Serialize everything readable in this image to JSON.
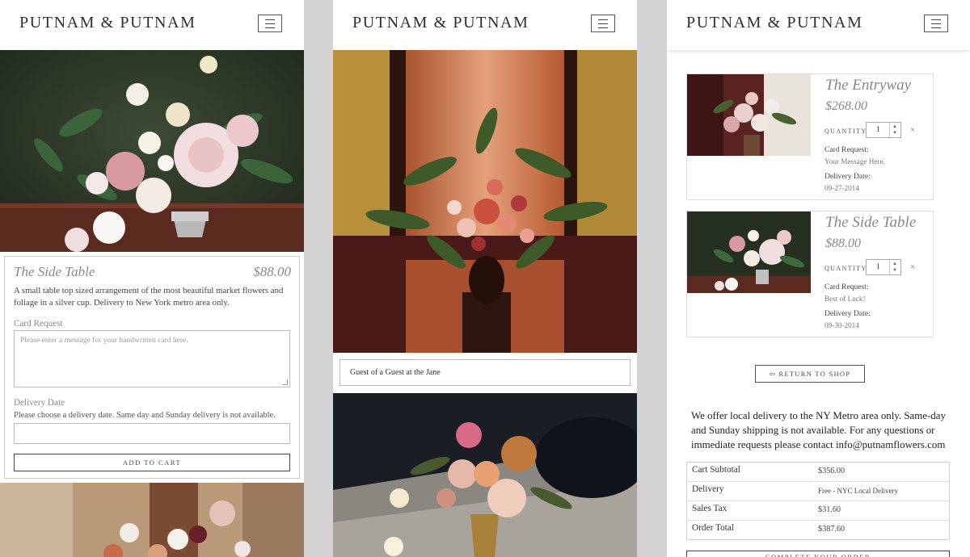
{
  "brand": "PUTNAM & PUTNAM",
  "colors": {
    "text": "#333333",
    "border": "#cccccc",
    "muted": "#888888",
    "gutter": "#d4d4d4"
  },
  "icons": {
    "menu": "hamburger-icon",
    "return": "arrow-left-icon",
    "remove": "close-icon"
  },
  "product": {
    "title": "The Side Table",
    "price": "$88.00",
    "description": "A small table top sized arrangement of the most beautiful market flowers and foliage in a silver cup. Delivery to New York metro area only.",
    "card_request_label": "Card Request",
    "card_request_placeholder": "Please enter a message for your handwritten card here.",
    "delivery_date_label": "Delivery Date",
    "delivery_date_help": "Please choose a delivery date. Same day and Sunday delivery is not available.",
    "add_to_cart": "ADD TO CART"
  },
  "gallery": {
    "caption": "Guest of a Guest at the Jane"
  },
  "cart": {
    "quantity_label": "QUANTITY",
    "card_request_label": "Card Request:",
    "delivery_date_label": "Delivery Date:",
    "remove_symbol": "×",
    "items": [
      {
        "title": "The Entryway",
        "price": "$268.00",
        "quantity": "1",
        "card_message": "Your Message Here.",
        "delivery_date": "09-27-2014"
      },
      {
        "title": "The Side Table",
        "price": "$88.00",
        "quantity": "1",
        "card_message": "Best of Luck!",
        "delivery_date": "09-30-2014"
      }
    ],
    "return_label": "RETURN TO SHOP",
    "info_text": "We offer local delivery to the NY Metro area only. Same-day and Sunday shipping is not available. For any questions or immediate requests please contact info@putnamflowers.com",
    "summary": [
      {
        "label": "Cart Subtotal",
        "value": "$356.00"
      },
      {
        "label": "Delivery",
        "value": "Free - NYC Local Delivery"
      },
      {
        "label": "Sales Tax",
        "value": "$31.60"
      },
      {
        "label": "Order Total",
        "value": "$387.60"
      }
    ],
    "complete_label": "COMPLETE YOUR ORDER"
  }
}
